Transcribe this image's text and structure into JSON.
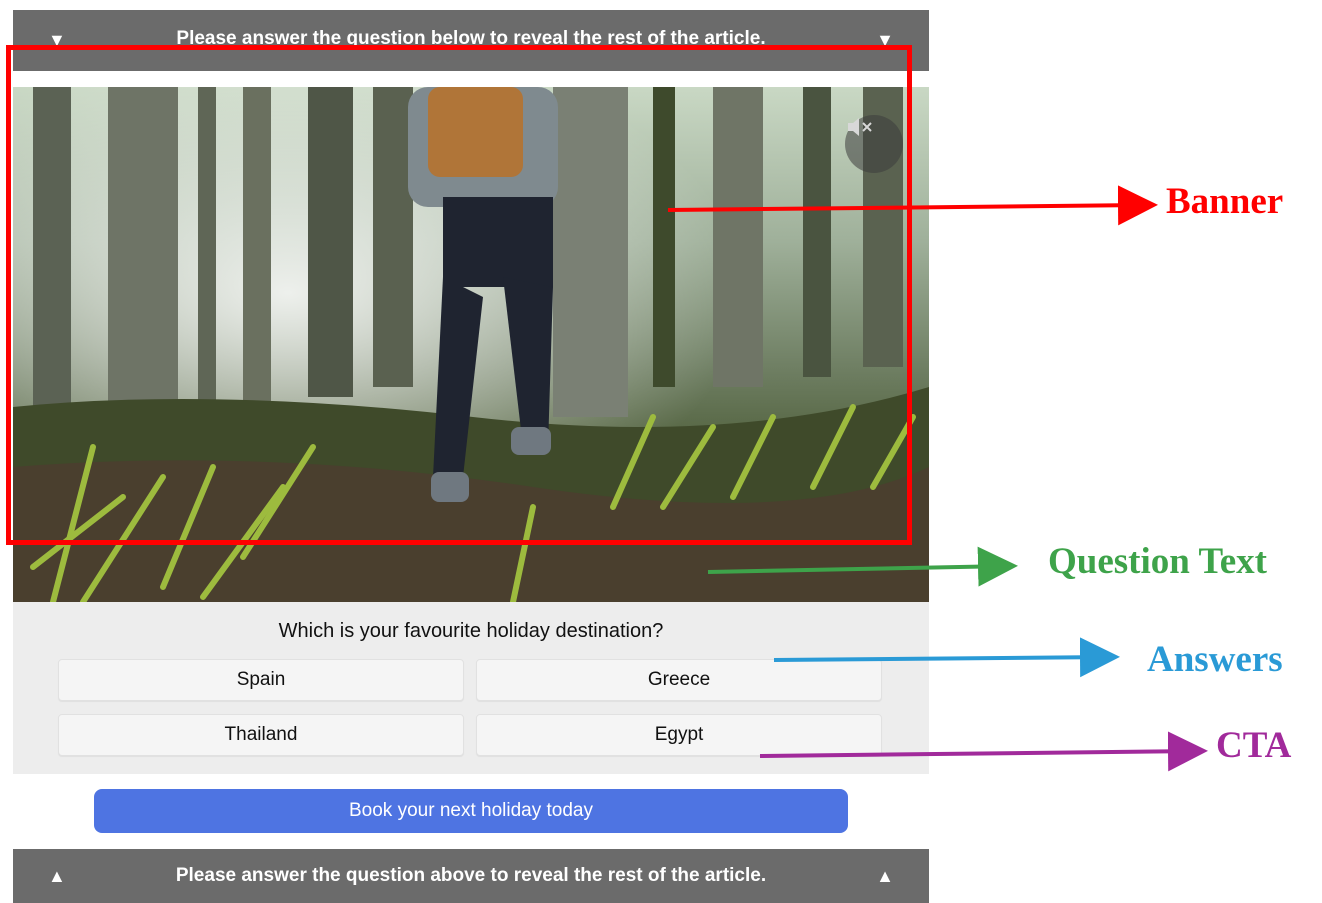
{
  "top_bar": {
    "text": "Please answer the question below to reveal the rest of the article.",
    "icon": "triangle-down"
  },
  "bottom_bar": {
    "text": "Please answer the question above to reveal the rest of the article.",
    "icon": "triangle-up"
  },
  "banner": {
    "mute_icon": "speaker-muted-icon"
  },
  "quiz": {
    "question": "Which is your favourite holiday destination?",
    "answers": [
      "Spain",
      "Greece",
      "Thailand",
      "Egypt"
    ]
  },
  "cta": {
    "label": "Book your next holiday today"
  },
  "annotations": {
    "banner": {
      "label": "Banner",
      "color": "#ff0000"
    },
    "question_text": {
      "label": "Question Text",
      "color": "#3ea34a"
    },
    "answers": {
      "label": "Answers",
      "color": "#2a9ad6"
    },
    "cta": {
      "label": "CTA",
      "color": "#a12a9b"
    }
  }
}
